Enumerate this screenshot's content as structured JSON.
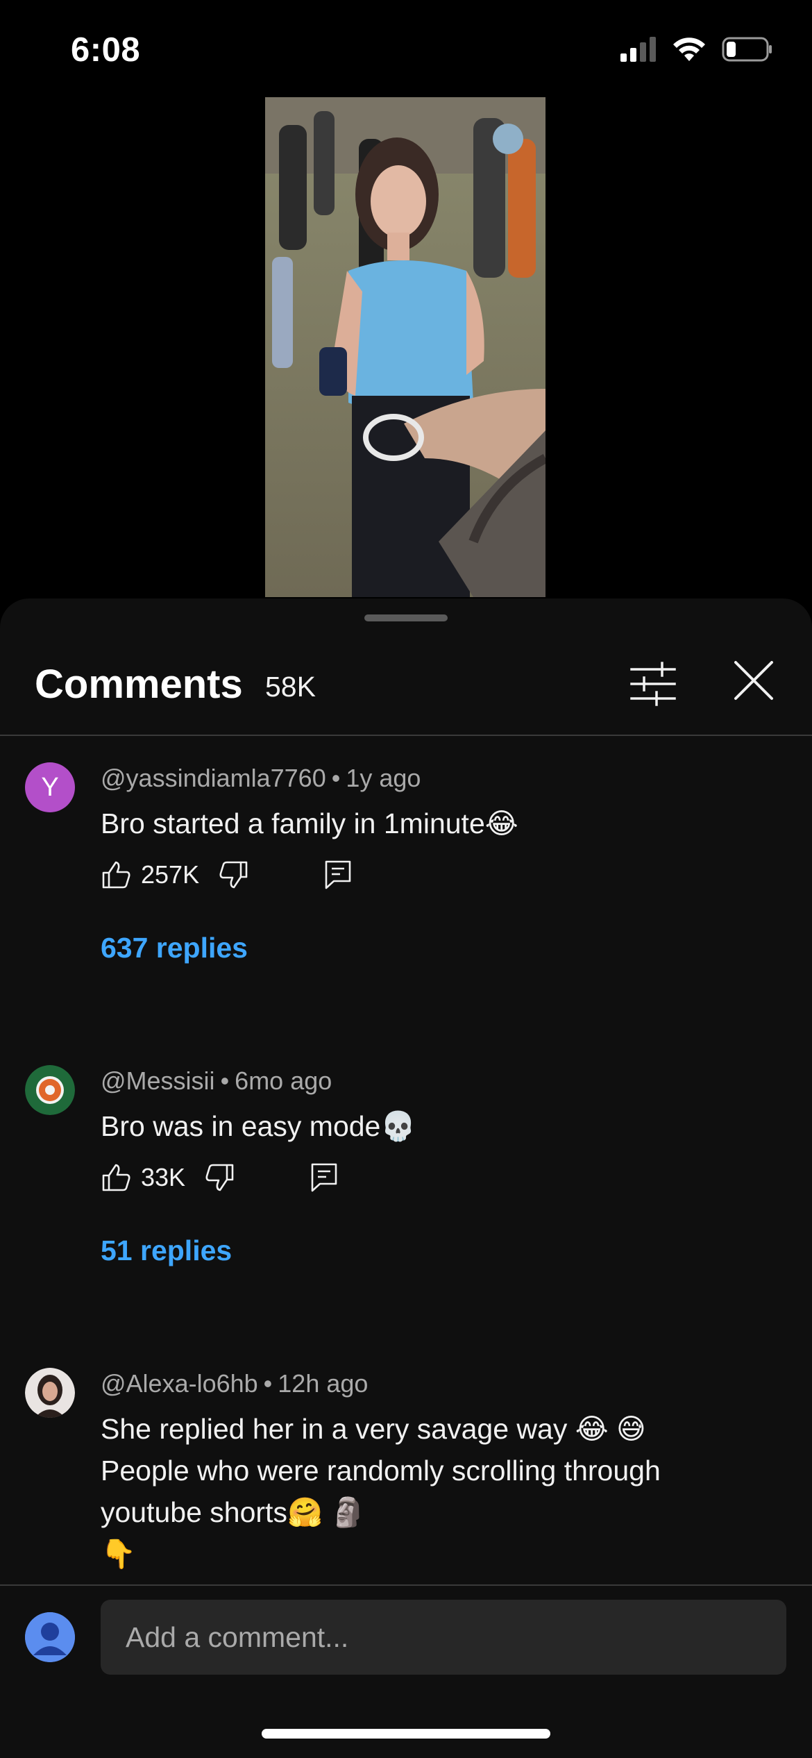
{
  "status_bar": {
    "time": "6:08"
  },
  "comments_panel": {
    "title": "Comments",
    "count": "58K",
    "filter_icon": "sliders-icon",
    "close_icon": "close-icon"
  },
  "comments": [
    {
      "avatar_letter": "Y",
      "avatar_color": "#b34fc9",
      "author": "@yassindiamla7760",
      "time": "1y ago",
      "text": "Bro started a family in 1minute😂",
      "likes": "257K",
      "replies_label": "637 replies"
    },
    {
      "author": "@Messisii",
      "time": "6mo ago",
      "text": "Bro was in easy mode💀",
      "likes": "33K",
      "replies_label": "51 replies"
    },
    {
      "author": "@Alexa-lo6hb",
      "time": "12h ago",
      "text_lines": [
        "She replied her in a very savage way 😂 😅",
        "People who were randomly scrolling through",
        "youtube shorts🤗 🗿",
        "👇"
      ]
    }
  ],
  "composer": {
    "placeholder": "Add a comment..."
  },
  "colors": {
    "accent_link": "#3ea6ff",
    "sheet_bg": "#0f0f0f",
    "input_bg": "#272727"
  }
}
